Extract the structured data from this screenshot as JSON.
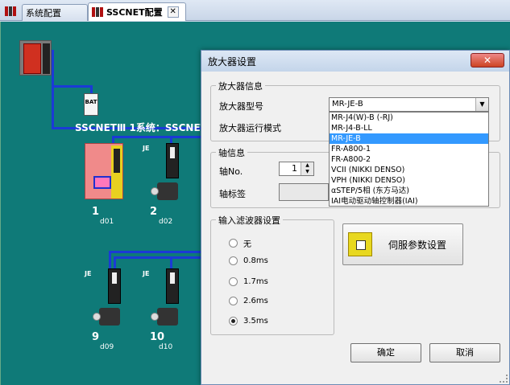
{
  "tabs": [
    {
      "label": "系统配置",
      "active": false
    },
    {
      "label": "SSCNET配置",
      "active": true
    }
  ],
  "tab_close_glyph": "✕",
  "canvas": {
    "battery_label": "BAT",
    "network_label": "SSCNETⅢ 1系统：SSCNETⅢ/H",
    "amp_type_label": "JE",
    "axes": [
      {
        "num": "1",
        "id": "d01"
      },
      {
        "num": "2",
        "id": "d02"
      },
      {
        "num": "9",
        "id": "d09"
      },
      {
        "num": "10",
        "id": "d10"
      }
    ]
  },
  "dialog": {
    "title": "放大器设置",
    "close_glyph": "✕",
    "amp_info": {
      "group_title": "放大器信息",
      "model_label": "放大器型号",
      "mode_label": "放大器运行模式",
      "model_value": "MR-JE-B",
      "options": [
        "MR-J4(W)-B (-RJ)",
        "MR-J4-B-LL",
        "MR-JE-B",
        "FR-A800-1",
        "FR-A800-2",
        "VCII  (NIKKI DENSO)",
        "VPH  (NIKKI DENSO)",
        "αSTEP/5相 (东方马达)",
        "IAI电动驱动轴控制器(IAI)"
      ],
      "selected_index": 2
    },
    "axis_info": {
      "group_title": "轴信息",
      "axis_no_label": "轴No.",
      "axis_no_value": "1",
      "axis_label_label": "轴标签",
      "axis_label_value": ""
    },
    "filter": {
      "group_title": "输入滤波器设置",
      "options": [
        "无",
        "0.8ms",
        "1.7ms",
        "2.6ms",
        "3.5ms"
      ],
      "selected": "3.5ms"
    },
    "servo_param_button": "伺服参数设置",
    "ok_button": "确定",
    "cancel_button": "取消"
  },
  "icons": [
    "system-config-icon",
    "sscnet-config-icon",
    "servo-param-icon",
    "spin-up-icon",
    "spin-down-icon",
    "dropdown-arrow-icon"
  ]
}
